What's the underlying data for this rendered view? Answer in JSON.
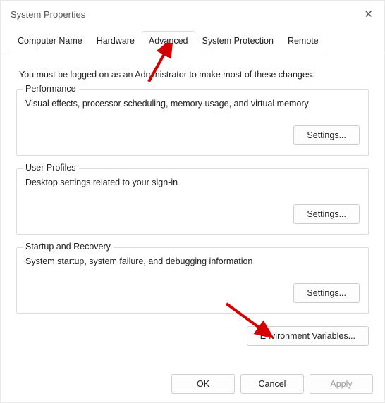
{
  "window": {
    "title": "System Properties",
    "close_icon": "✕"
  },
  "tabs": {
    "computer_name": "Computer Name",
    "hardware": "Hardware",
    "advanced": "Advanced",
    "system_protection": "System Protection",
    "remote": "Remote"
  },
  "intro": "You must be logged on as an Administrator to make most of these changes.",
  "groups": {
    "performance": {
      "legend": "Performance",
      "desc": "Visual effects, processor scheduling, memory usage, and virtual memory",
      "settings_label": "Settings..."
    },
    "user_profiles": {
      "legend": "User Profiles",
      "desc": "Desktop settings related to your sign-in",
      "settings_label": "Settings..."
    },
    "startup": {
      "legend": "Startup and Recovery",
      "desc": "System startup, system failure, and debugging information",
      "settings_label": "Settings..."
    }
  },
  "env_button": "Environment Variables...",
  "footer": {
    "ok": "OK",
    "cancel": "Cancel",
    "apply": "Apply"
  },
  "annotations": {
    "arrow_color": "#d40000"
  }
}
